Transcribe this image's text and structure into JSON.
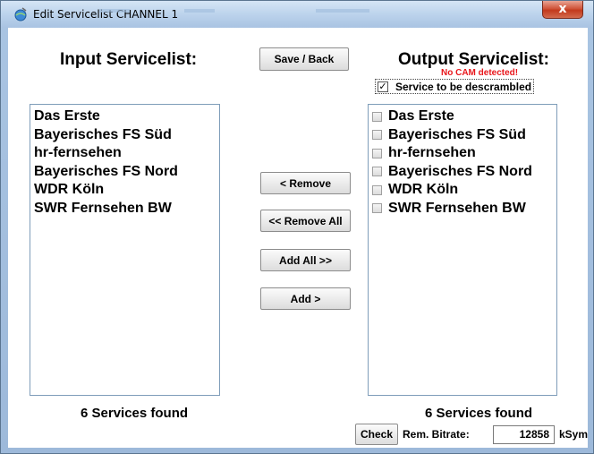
{
  "window": {
    "title": "Edit Servicelist CHANNEL 1",
    "close_glyph": "x"
  },
  "input_panel": {
    "heading": "Input Servicelist:",
    "services": [
      "Das Erste",
      "Bayerisches FS Süd",
      "hr-fernsehen",
      "Bayerisches FS Nord",
      "WDR Köln",
      "SWR Fernsehen BW"
    ],
    "count_label": "6 Services found"
  },
  "output_panel": {
    "heading": "Output Servicelist:",
    "warning": "No CAM detected!",
    "descramble_label": "Service to be descrambled",
    "descramble_checked": true,
    "descramble_mark": "✓",
    "services": [
      "Das Erste",
      "Bayerisches FS Süd",
      "hr-fernsehen",
      "Bayerisches FS Nord",
      "WDR Köln",
      "SWR Fernsehen BW"
    ],
    "count_label": "6 Services found"
  },
  "buttons": {
    "save_back": "Save / Back",
    "remove": "< Remove",
    "remove_all": "<< Remove All",
    "add_all": "Add All  >>",
    "add": "Add >",
    "check": "Check"
  },
  "bitrate": {
    "label": "Rem. Bitrate:",
    "value": "12858",
    "unit": "kSym"
  },
  "colors": {
    "warning": "#e8161b",
    "list_border": "#7f9db9",
    "title_bar": "#bcd3ec"
  },
  "icons": {
    "title": "globe-satellite-icon",
    "close": "close-icon"
  }
}
